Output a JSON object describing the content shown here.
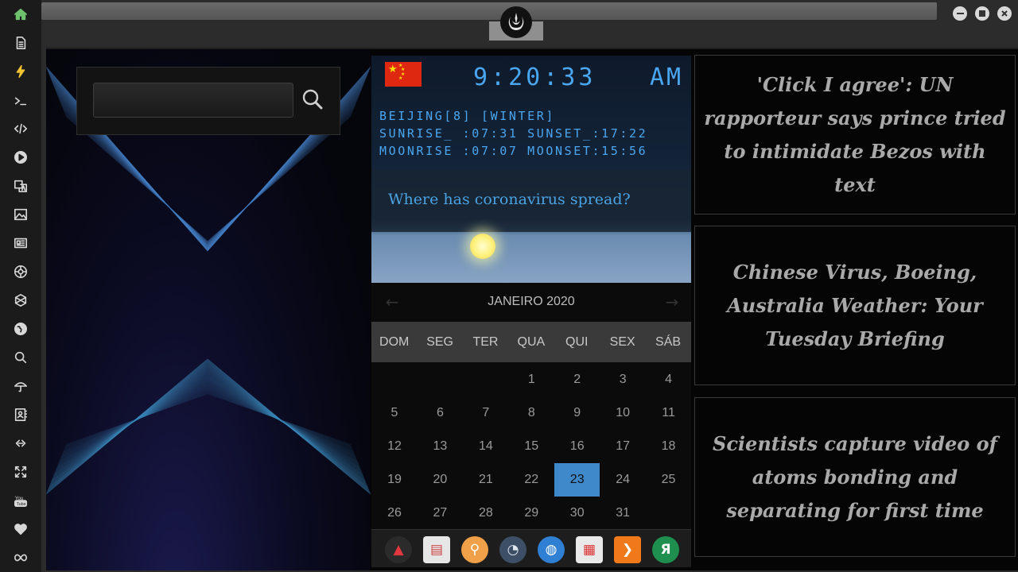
{
  "sidebar": {
    "items": [
      {
        "name": "home-icon"
      },
      {
        "name": "document-icon"
      },
      {
        "name": "bolt-icon"
      },
      {
        "name": "terminal-icon"
      },
      {
        "name": "code-icon"
      },
      {
        "name": "play-icon"
      },
      {
        "name": "translate-icon"
      },
      {
        "name": "image-icon"
      },
      {
        "name": "newspaper-icon"
      },
      {
        "name": "empire-icon"
      },
      {
        "name": "hexagon-icon"
      },
      {
        "name": "globe-icon"
      },
      {
        "name": "search-icon"
      },
      {
        "name": "umbrella-icon"
      },
      {
        "name": "contacts-icon"
      },
      {
        "name": "link-icon"
      },
      {
        "name": "expand-icon"
      },
      {
        "name": "youtube-icon"
      },
      {
        "name": "heart-icon"
      },
      {
        "name": "infinity-icon"
      }
    ]
  },
  "search": {
    "value": "",
    "placeholder": ""
  },
  "clock": {
    "time": "9:20:33",
    "ampm": "AM",
    "location_line": "BEIJING[8] [WINTER]",
    "sun_line": "SUNRISE_ :07:31 SUNSET_:17:22",
    "moon_line": "MOONRISE :07:07 MOONSET:15:56",
    "headline": "Where has coronavirus spread?",
    "flag_colors": {
      "field": "#de2910",
      "star": "#ffde00"
    }
  },
  "calendar": {
    "prev_icon": "arrow-left-icon",
    "next_icon": "arrow-right-icon",
    "month_label": "JANEIRO 2020",
    "weekdays": [
      "DOM",
      "SEG",
      "TER",
      "QUA",
      "QUI",
      "SEX",
      "SÁB"
    ],
    "days": [
      "1",
      "2",
      "3",
      "4",
      "5",
      "6",
      "7",
      "8",
      "9",
      "10",
      "11",
      "12",
      "13",
      "14",
      "15",
      "16",
      "17",
      "18",
      "19",
      "20",
      "21",
      "22",
      "23",
      "24",
      "25",
      "26",
      "27",
      "28",
      "29",
      "30",
      "31"
    ],
    "first_weekday_index": 3,
    "today": "23",
    "accent": "#3f88c9"
  },
  "dock": {
    "items": [
      {
        "name": "vivaldi-app-icon",
        "color": "#2b2b2b"
      },
      {
        "name": "news-app-icon",
        "color": "#e6e6e6"
      },
      {
        "name": "search-app-icon",
        "color": "#f0a048"
      },
      {
        "name": "clock-app-icon",
        "color": "#3d4f66"
      },
      {
        "name": "browser-globe-icon",
        "color": "#2f7fd2"
      },
      {
        "name": "calendar-app-icon",
        "color": "#e9e9e9"
      },
      {
        "name": "arrow-app-icon",
        "color": "#f07a1a"
      },
      {
        "name": "yandex-app-icon",
        "color": "#1f8f4f"
      }
    ]
  },
  "news": [
    {
      "title": "'Click I agree': UN rapporteur says prince tried to intimidate Bezos with text"
    },
    {
      "title": "Chinese Virus, Boeing, Australia Weather: Your Tuesday Briefing"
    },
    {
      "title": "Scientists capture video of atoms bonding and separating for first time"
    }
  ]
}
